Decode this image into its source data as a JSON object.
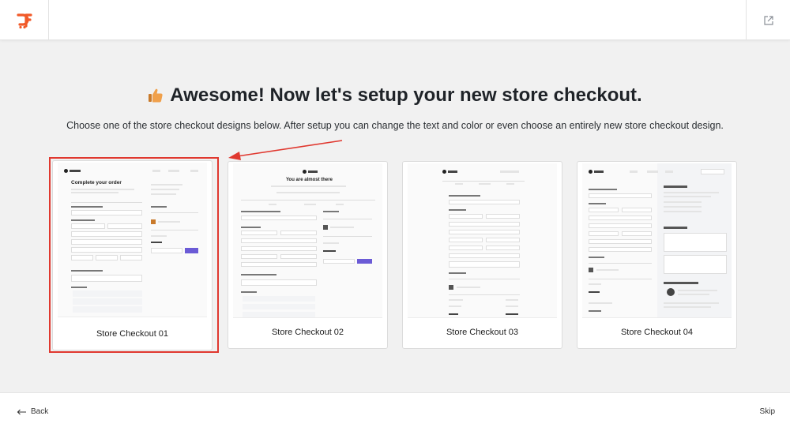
{
  "header": {
    "logo_icon": "cartflows-logo-icon",
    "exit_icon": "external-link-icon"
  },
  "main": {
    "heading_icon": "thumbs-up-icon",
    "heading": "Awesome! Now let's setup your new store checkout.",
    "subheading": "Choose one of the store checkout designs below. After setup you can change the text and color or even choose an entirely new store checkout design."
  },
  "cards": [
    {
      "label": "Store Checkout 01",
      "selected": true,
      "thumb_title": "Complete your order"
    },
    {
      "label": "Store Checkout 02",
      "selected": false,
      "thumb_title": "You are almost there"
    },
    {
      "label": "Store Checkout 03",
      "selected": false,
      "thumb_title": ""
    },
    {
      "label": "Store Checkout 04",
      "selected": false,
      "thumb_title": ""
    }
  ],
  "footer": {
    "back_label": "Back",
    "back_icon": "arrow-left-icon",
    "skip_label": "Skip"
  },
  "colors": {
    "brand": "#f15a29",
    "selection": "#e0382f",
    "accent_button": "#6b5bd6",
    "thumbs_up": "#f0a04b"
  }
}
